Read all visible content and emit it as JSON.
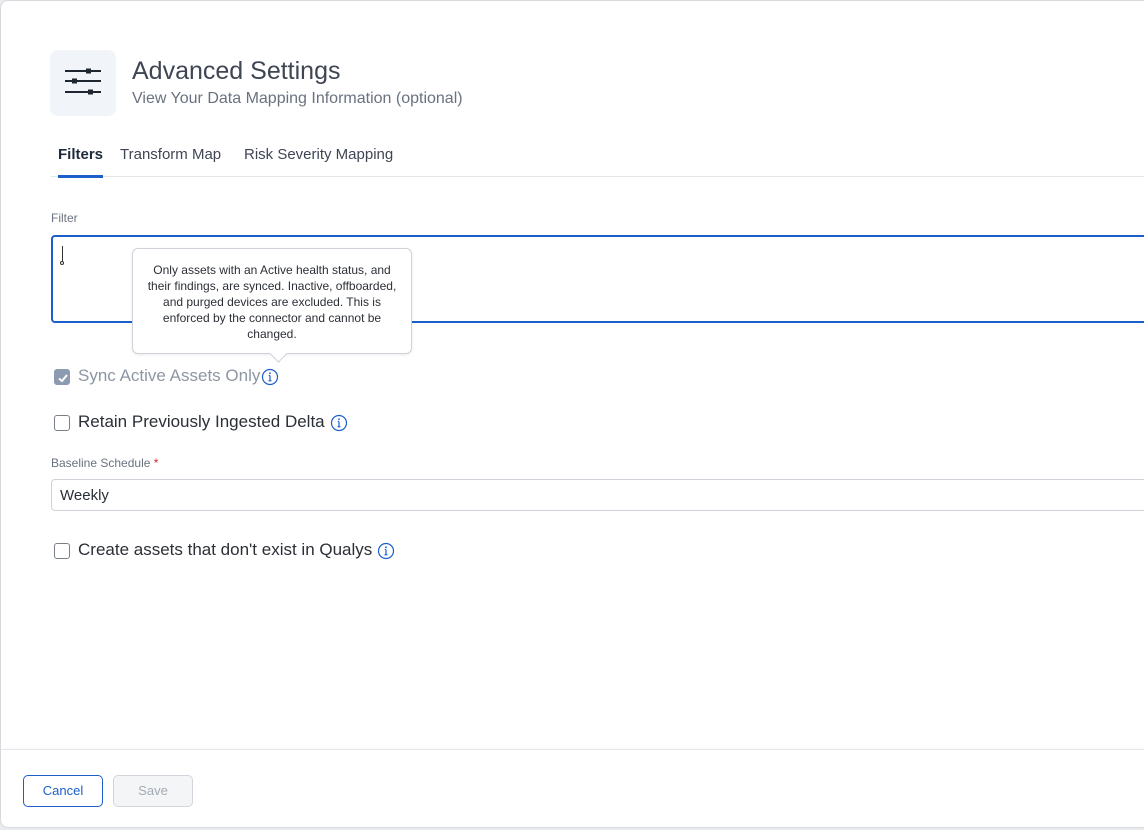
{
  "header": {
    "title": "Advanced Settings",
    "subtitle": "View Your Data Mapping Information (optional)",
    "icon": "sliders-icon"
  },
  "tabs": [
    {
      "label": "Filters",
      "active": true
    },
    {
      "label": "Transform Map",
      "active": false
    },
    {
      "label": "Risk Severity Mapping",
      "active": false
    }
  ],
  "filter": {
    "label": "Filter",
    "value": ""
  },
  "tooltip": {
    "text": "Only assets with an Active health status, and their findings, are synced. Inactive, offboarded, and purged devices are excluded. This is enforced by the connector and cannot be changed."
  },
  "options": {
    "sync_active": {
      "label": "Sync Active Assets Only",
      "checked": true,
      "disabled": true
    },
    "retain_delta": {
      "label": "Retain Previously Ingested Delta",
      "checked": false
    },
    "create_assets": {
      "label": "Create assets that don't exist in Qualys",
      "checked": false
    }
  },
  "baseline": {
    "label": "Baseline Schedule",
    "required_mark": "*",
    "value": "Weekly"
  },
  "footer": {
    "cancel_label": "Cancel",
    "save_label": "Save"
  },
  "colors": {
    "accent": "#1c5fcb",
    "required": "#d12a2a",
    "disabled_text": "#8d96a3"
  }
}
